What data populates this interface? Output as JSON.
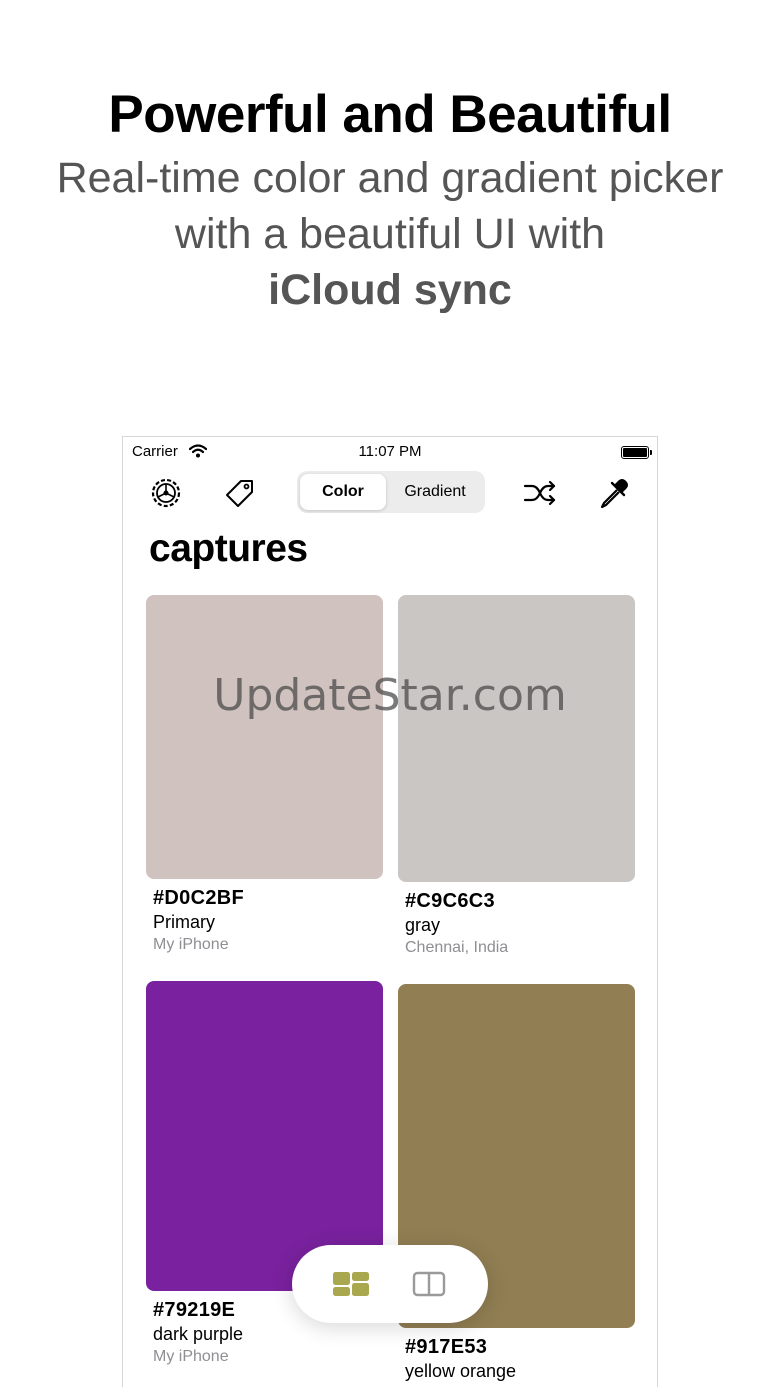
{
  "promo": {
    "headline": "Powerful and Beautiful",
    "line1": "Real-time color and gradient picker",
    "line2": "with a beautiful UI with",
    "line3": "iCloud sync"
  },
  "status_bar": {
    "carrier": "Carrier",
    "time": "11:07 PM"
  },
  "toolbar": {
    "segments": [
      "Color",
      "Gradient"
    ],
    "selected_segment": "Color",
    "icons": [
      "settings-icon",
      "tag-icon",
      "shuffle-icon",
      "eyedropper-icon"
    ]
  },
  "screen_title": "captures",
  "captures": [
    {
      "hex": "#D0C2BF",
      "name": "Primary",
      "location": "My iPhone",
      "color": "#D0C2BF"
    },
    {
      "hex": "#C9C6C3",
      "name": "gray",
      "location": "Chennai, India",
      "color": "#C9C6C3"
    },
    {
      "hex": "#79219E",
      "name": "dark purple",
      "location": "My iPhone",
      "color": "#79219E"
    },
    {
      "hex": "#917E53",
      "name": "yellow orange",
      "location": "",
      "color": "#917E53"
    }
  ],
  "view_toggle": {
    "icons": [
      "grid-view-icon",
      "split-view-icon"
    ],
    "selected": "grid-view-icon",
    "accent": "#A9A84F"
  },
  "watermark": "UpdateStar.com"
}
